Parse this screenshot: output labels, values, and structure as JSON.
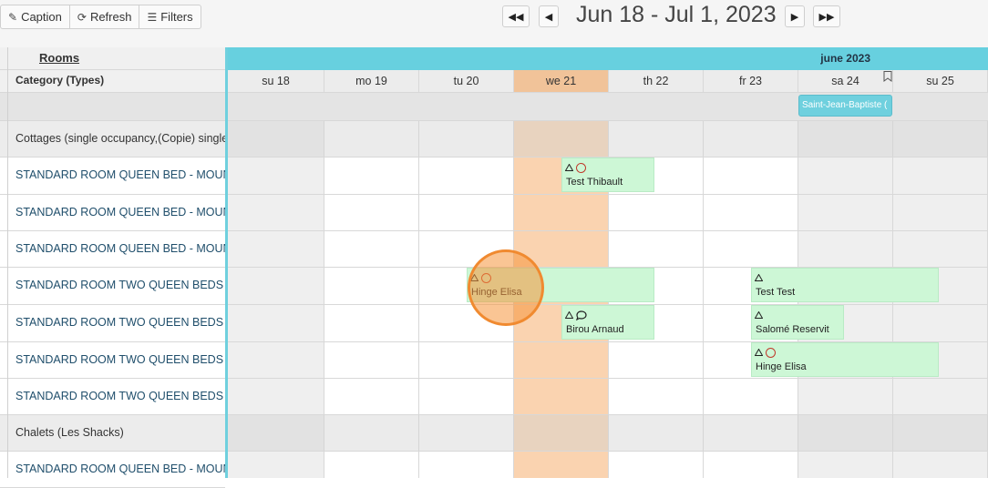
{
  "toolbar": {
    "caption_label": "Caption",
    "refresh_label": "Refresh",
    "filters_label": "Filters",
    "date_range": "Jun 18 - Jul 1, 2023"
  },
  "left": {
    "rooms_header": "Rooms",
    "category_header": "Category (Types)",
    "rows": [
      {
        "label": "Cottages (single occupancy,(Copie) single"
      },
      {
        "label": "STANDARD ROOM QUEEN BED - MOUNTA"
      },
      {
        "label": "STANDARD ROOM QUEEN BED - MOUNTA"
      },
      {
        "label": "STANDARD ROOM QUEEN BED - MOUNTA"
      },
      {
        "label": "STANDARD ROOM TWO QUEEN BEDS - M"
      },
      {
        "label": "STANDARD ROOM TWO QUEEN BEDS - M"
      },
      {
        "label": "STANDARD ROOM TWO QUEEN BEDS - M"
      },
      {
        "label": "STANDARD ROOM TWO QUEEN BEDS - M"
      },
      {
        "label": "Chalets (Les Shacks)"
      },
      {
        "label": "STANDARD ROOM QUEEN BED - MOUNTA"
      }
    ]
  },
  "calendar": {
    "month_label": "june 2023",
    "days": [
      "su 18",
      "mo 19",
      "tu 20",
      "we 21",
      "th 22",
      "fr 23",
      "sa 24",
      "su 25"
    ],
    "holiday": "Saint-Jean-Baptiste (",
    "bookings": [
      {
        "name": "Test Thibault"
      },
      {
        "name": "Hinge Elisa"
      },
      {
        "name": "Test Test"
      },
      {
        "name": "Birou Arnaud"
      },
      {
        "name": "Salomé Reservit"
      },
      {
        "name": "Hinge Elisa"
      }
    ]
  },
  "colors": {
    "month_bar": "#67d0df",
    "today": "#fad3b0",
    "booking": "#cdf7d6",
    "note_circle": "#c0392b"
  }
}
